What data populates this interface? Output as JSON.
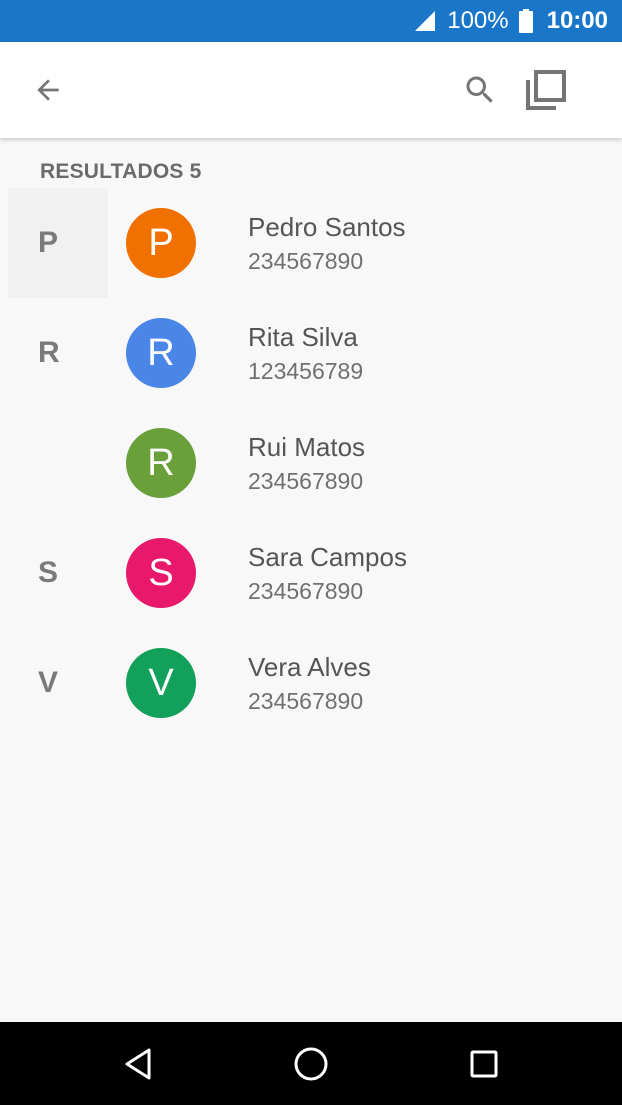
{
  "status_bar": {
    "battery_percent": "100%",
    "time": "10:00",
    "icons": [
      "signal-icon",
      "battery-icon"
    ]
  },
  "app_bar": {
    "icons": [
      "back-arrow-icon",
      "search-icon",
      "copy-icon"
    ]
  },
  "results": {
    "label": "RESULTADOS",
    "count": "5"
  },
  "contacts": [
    {
      "letter": "P",
      "initial": "P",
      "name": "Pedro Santos",
      "phone": "234567890",
      "color": "#f07000"
    },
    {
      "letter": "R",
      "initial": "R",
      "name": "Rita Silva",
      "phone": "123456789",
      "color": "#4a86e8"
    },
    {
      "letter": "",
      "initial": "R",
      "name": "Rui Matos",
      "phone": "234567890",
      "color": "#6aa03a"
    },
    {
      "letter": "S",
      "initial": "S",
      "name": "Sara Campos",
      "phone": "234567890",
      "color": "#e8196b"
    },
    {
      "letter": "V",
      "initial": "V",
      "name": "Vera Alves",
      "phone": "234567890",
      "color": "#12a05a"
    }
  ],
  "nav_bar": {
    "icons": [
      "nav-back-icon",
      "nav-home-icon",
      "nav-recents-icon"
    ]
  }
}
